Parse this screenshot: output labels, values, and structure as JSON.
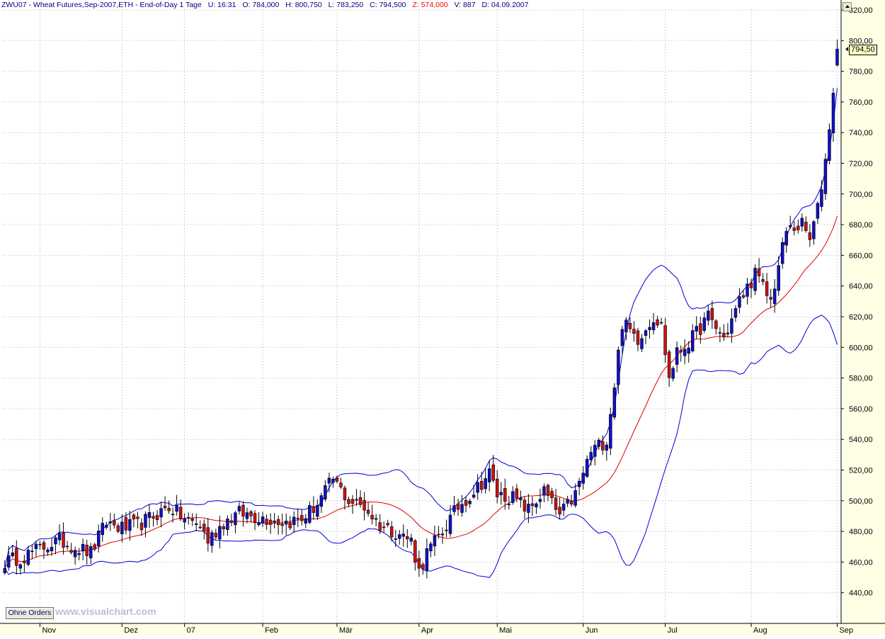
{
  "header": {
    "symbol": "ZWU07 - Wheat Futures,Sep-2007,ETH - End-of-Day 1 Tage",
    "time": "U: 16:31",
    "open": "O: 784,000",
    "high": "H: 800,750",
    "low": "L: 783,250",
    "close": "C: 794,500",
    "z": "Z: 574,000",
    "volume": "V: 887",
    "date": "D: 04.09.2007"
  },
  "footer": {
    "orders_button": "Ohne Orders",
    "watermark": "www.visualchart.com"
  },
  "price_label": "794,50",
  "colors": {
    "up": "#1010c8",
    "down": "#d01010",
    "bands": "#0000dd",
    "ma": "#e00000",
    "grid": "#b0b0b0",
    "axis_bg": "#ffffe6"
  },
  "chart_data": {
    "type": "candlestick",
    "title": "ZWU07 - Wheat Futures,Sep-2007",
    "ylim": [
      420,
      820
    ],
    "y_ticks": [
      440,
      460,
      480,
      500,
      520,
      540,
      560,
      580,
      600,
      620,
      640,
      660,
      680,
      700,
      720,
      740,
      760,
      780,
      800,
      820
    ],
    "y_tick_labels": [
      "440,00",
      "460,00",
      "480,00",
      "500,00",
      "520,00",
      "540,00",
      "560,00",
      "580,00",
      "600,00",
      "620,00",
      "640,00",
      "660,00",
      "680,00",
      "700,00",
      "720,00",
      "740,00",
      "760,00",
      "780,00",
      "800,00",
      "820,00"
    ],
    "x_months": [
      {
        "label": "Nov",
        "index": 9
      },
      {
        "label": "Dez",
        "index": 30
      },
      {
        "label": "07",
        "index": 46
      },
      {
        "label": "Feb",
        "index": 66
      },
      {
        "label": "Mär",
        "index": 85
      },
      {
        "label": "Apr",
        "index": 106
      },
      {
        "label": "Mai",
        "index": 126
      },
      {
        "label": "Jun",
        "index": 148
      },
      {
        "label": "Jul",
        "index": 169
      },
      {
        "label": "Aug",
        "index": 191
      },
      {
        "label": "Sep",
        "index": 213
      }
    ],
    "bar_count": 214,
    "key_points": [
      [
        0,
        460
      ],
      [
        5,
        464
      ],
      [
        10,
        470
      ],
      [
        14,
        474
      ],
      [
        18,
        470
      ],
      [
        22,
        466
      ],
      [
        26,
        486
      ],
      [
        30,
        482
      ],
      [
        34,
        484
      ],
      [
        38,
        490
      ],
      [
        42,
        496
      ],
      [
        46,
        488
      ],
      [
        50,
        484
      ],
      [
        52,
        474
      ],
      [
        56,
        486
      ],
      [
        60,
        492
      ],
      [
        64,
        490
      ],
      [
        68,
        488
      ],
      [
        72,
        486
      ],
      [
        76,
        488
      ],
      [
        80,
        498
      ],
      [
        84,
        514
      ],
      [
        88,
        500
      ],
      [
        92,
        496
      ],
      [
        96,
        484
      ],
      [
        100,
        480
      ],
      [
        104,
        474
      ],
      [
        106,
        454
      ],
      [
        108,
        466
      ],
      [
        112,
        480
      ],
      [
        116,
        496
      ],
      [
        120,
        506
      ],
      [
        124,
        518
      ],
      [
        126,
        504
      ],
      [
        130,
        502
      ],
      [
        134,
        494
      ],
      [
        138,
        506
      ],
      [
        142,
        490
      ],
      [
        146,
        504
      ],
      [
        150,
        532
      ],
      [
        154,
        540
      ],
      [
        156,
        576
      ],
      [
        158,
        616
      ],
      [
        162,
        606
      ],
      [
        166,
        620
      ],
      [
        168,
        614
      ],
      [
        170,
        580
      ],
      [
        172,
        596
      ],
      [
        176,
        606
      ],
      [
        180,
        620
      ],
      [
        184,
        606
      ],
      [
        188,
        630
      ],
      [
        192,
        648
      ],
      [
        196,
        630
      ],
      [
        200,
        676
      ],
      [
        204,
        680
      ],
      [
        206,
        670
      ],
      [
        208,
        690
      ],
      [
        210,
        722
      ],
      [
        212,
        768
      ],
      [
        213,
        794.5
      ]
    ],
    "last_bar": {
      "open": 784.0,
      "high": 800.75,
      "low": 783.25,
      "close": 794.5
    },
    "indicators": {
      "moving_average": {
        "period": 20,
        "color": "#e00000"
      },
      "bollinger_bands": {
        "period": 20,
        "deviation": 2,
        "color": "#0000dd"
      }
    },
    "grid": true
  }
}
